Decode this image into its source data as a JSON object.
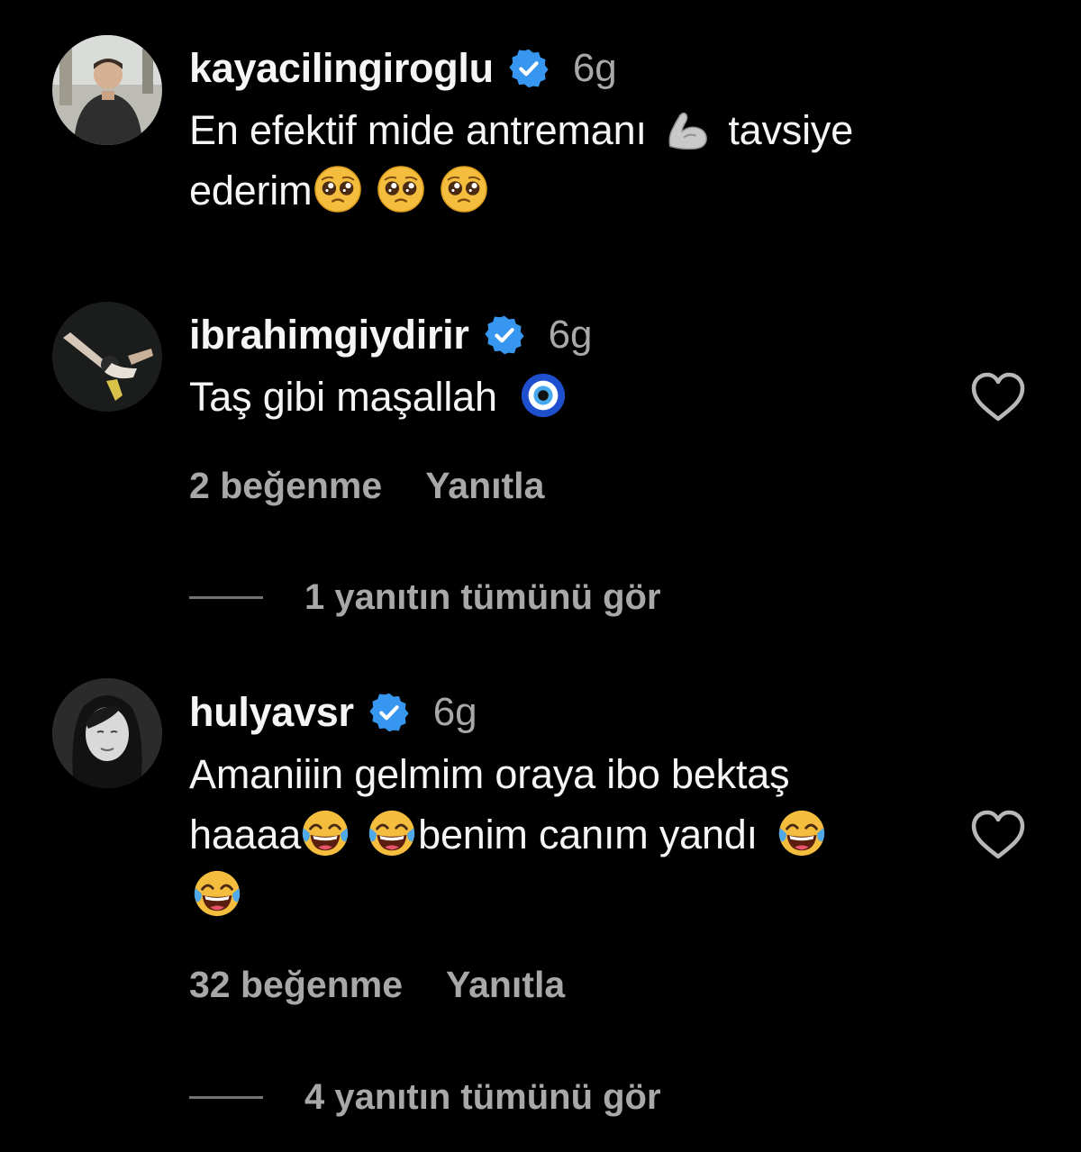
{
  "comments": [
    {
      "username": "kayacilingiroglu",
      "time": "6g",
      "text_line1": "En efektif mide antremanı ",
      "text_line1_after": " tavsiye",
      "text_line2": "ederim",
      "emojis": [
        "flexed-biceps",
        "pleading-face",
        "pleading-face",
        "pleading-face"
      ]
    },
    {
      "username": "ibrahimgiydirir",
      "time": "6g",
      "text": "Taş gibi maşallah ",
      "emojis": [
        "nazar-amulet"
      ],
      "likes": "2 beğenme",
      "reply": "Yanıtla",
      "view_replies": "1 yanıtın tümünü gör"
    },
    {
      "username": "hulyavsr",
      "time": "6g",
      "text_line1": "Amaniiin gelmim oraya ibo bektaş",
      "text_line2_a": "haaaa",
      "text_line2_b": "benim canım yandı ",
      "emojis": [
        "tears-of-joy",
        "tears-of-joy",
        "tears-of-joy",
        "tears-of-joy"
      ],
      "likes": "32 beğenme",
      "reply": "Yanıtla",
      "view_replies": "4 yanıtın tümünü gör"
    }
  ],
  "colors": {
    "background": "#000000",
    "primary_text": "#f5f5f5",
    "secondary_text": "#a8a8a8",
    "verified_blue": "#3797f0"
  },
  "icons": {
    "verified": "verified-badge-icon",
    "like": "heart-outline-icon"
  }
}
